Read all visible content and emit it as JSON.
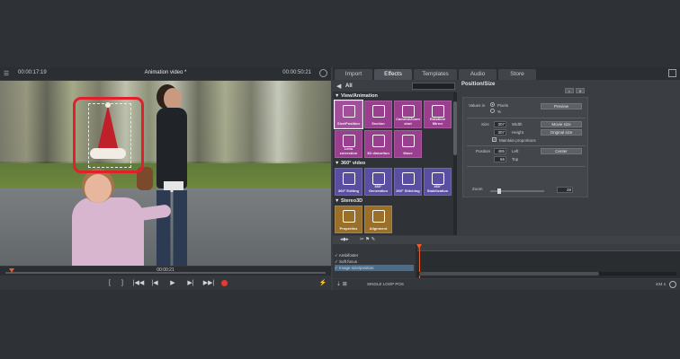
{
  "player": {
    "menu_icon": "☰",
    "timecode_left": "00:00:17:19",
    "title": "Animation video *",
    "timecode_right": "00:00:50:21",
    "scrub_time": "00:00:21",
    "transport": {
      "mark_in": "[",
      "mark_out": "]",
      "prev_marker": "|◀◀",
      "prev": "|◀",
      "play": "▶",
      "next": "▶|",
      "next_marker": "▶▶|",
      "mute": "⚡"
    }
  },
  "tabs": [
    "Import",
    "Effects",
    "Templates",
    "Audio",
    "Store"
  ],
  "browser": {
    "back": "◀",
    "all_label": "All",
    "sections": [
      {
        "title": "▼ View/Animation",
        "tiles": [
          {
            "label": "Size/Position",
            "color": "#a24f9b",
            "icon": "move-icon"
          },
          {
            "label": "Section",
            "color": "#9a3e8f",
            "icon": "crop-icon"
          },
          {
            "label": "Camera/Zoom shot",
            "color": "#9a3e8f",
            "icon": "camera-icon"
          },
          {
            "label": "Rotation/ Mirror",
            "color": "#9a3e8f",
            "icon": "rotate-icon"
          },
          {
            "label": "Lens correction",
            "color": "#9a3e8f",
            "icon": "lens-icon"
          },
          {
            "label": "3D distortion",
            "color": "#9a3e8f",
            "icon": "3d-icon"
          },
          {
            "label": "Move",
            "color": "#9a3e8f",
            "icon": "hex-icon"
          }
        ]
      },
      {
        "title": "▼ 360° video",
        "tiles": [
          {
            "label": "360° Editing",
            "color": "#5a4ea0",
            "icon": "360-edit-icon"
          },
          {
            "label": "360° Generation",
            "color": "#5a4ea0",
            "icon": "360-gen-icon"
          },
          {
            "label": "360° Stitching",
            "color": "#5a4ea0",
            "icon": "360-stitch-icon"
          },
          {
            "label": "360° Stabilization",
            "color": "#5a4ea0",
            "icon": "360-stab-icon"
          }
        ]
      },
      {
        "title": "▼ Stereo3D",
        "tiles": [
          {
            "label": "Properties",
            "color": "#9a6f2a",
            "icon": "glasses-icon"
          },
          {
            "label": "Alignment",
            "color": "#9a6f2a",
            "icon": "align-icon"
          }
        ]
      }
    ]
  },
  "props": {
    "title": "Position/Size",
    "values_in": "Values in",
    "unit_pixels": "Pixels",
    "unit_percent": "%",
    "preview": "Preview",
    "size_label": "Size",
    "width_value": "307",
    "width_label": "Width",
    "height_value": "307",
    "height_label": "Height",
    "movie_size": "Movie size",
    "original_size": "Original size",
    "maintain": "Maintain proportions",
    "position_label": "Position",
    "left_value": "485",
    "left_label": "Left",
    "top_value": "66",
    "top_label": "Top",
    "center": "Center",
    "zoom_label": "Zoom",
    "zoom_value": "28"
  },
  "timeline": {
    "tracks": [
      {
        "name": "Ambifoster"
      },
      {
        "name": "Soft focus"
      },
      {
        "name": "Image size/position"
      }
    ],
    "status_loop": "SINGLE LOOP POS",
    "memory": "434 s"
  }
}
